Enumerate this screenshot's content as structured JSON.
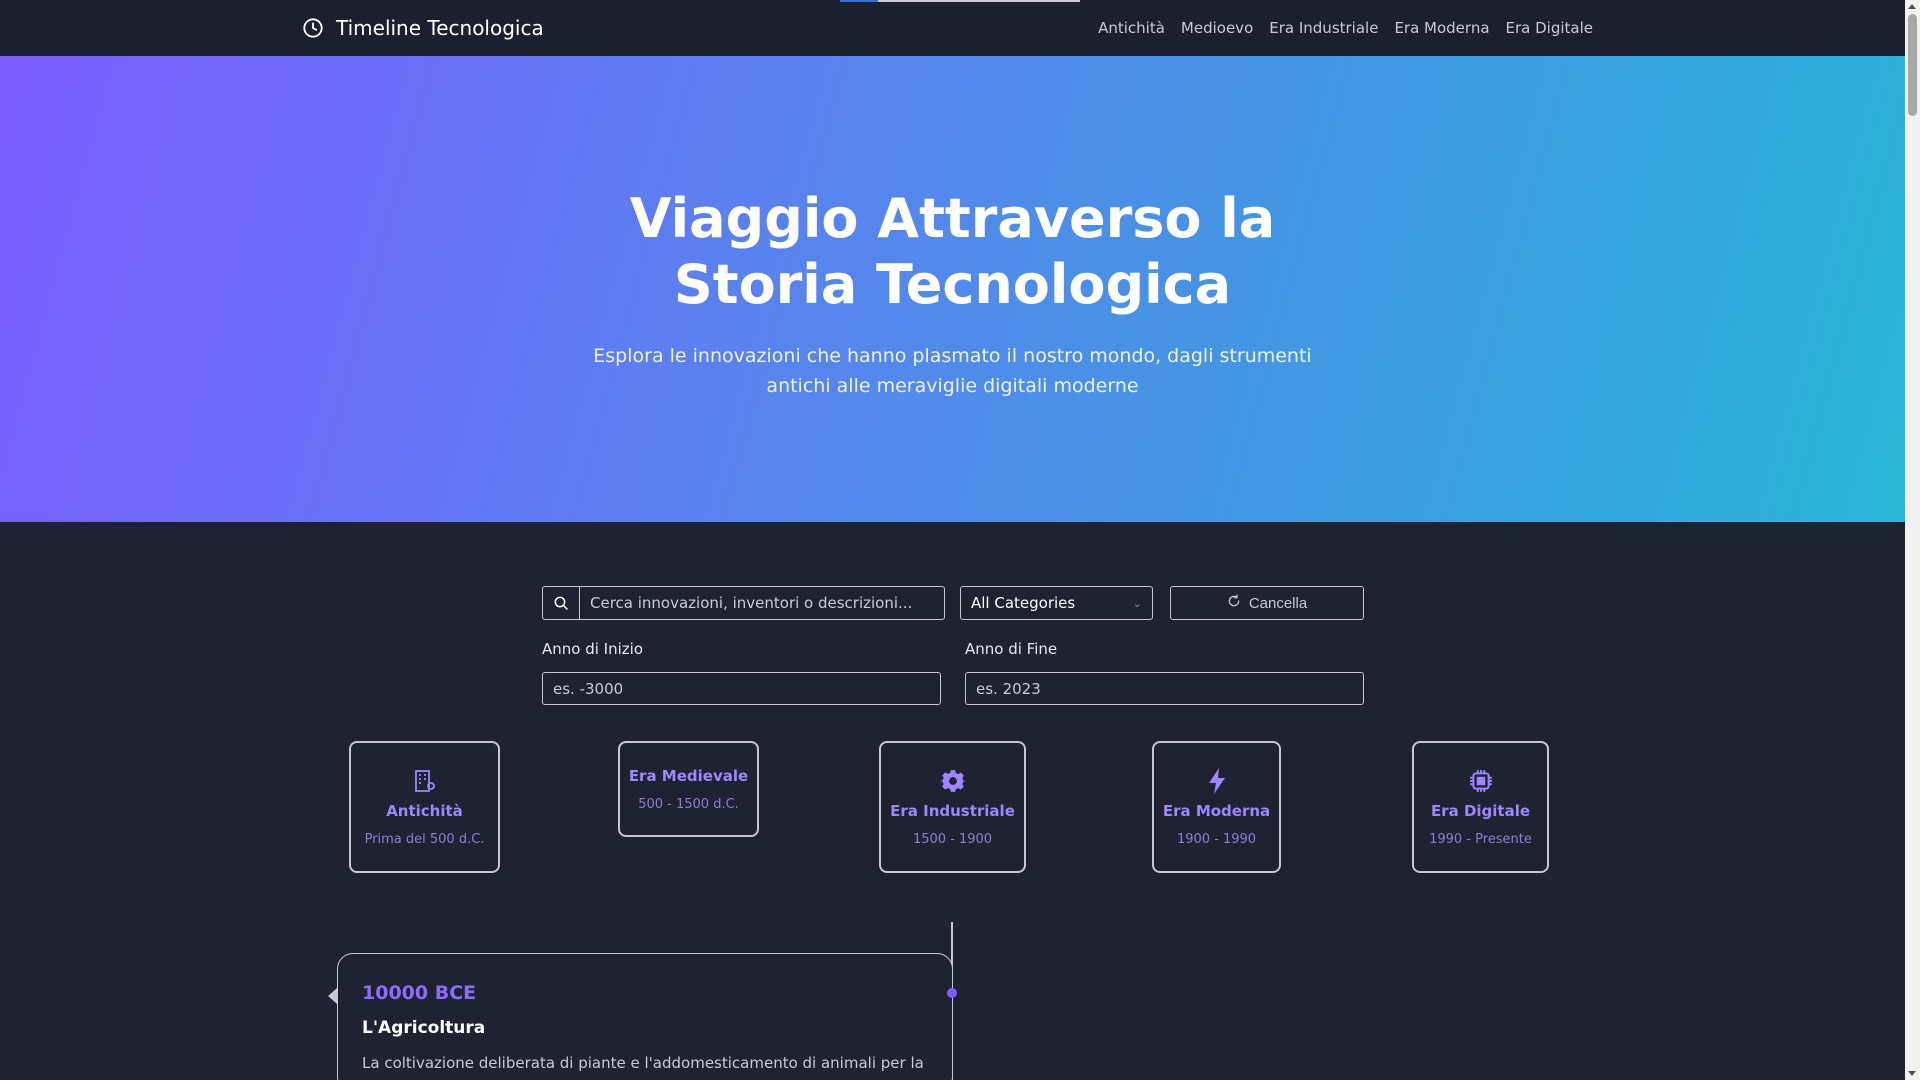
{
  "nav": {
    "brand": "Timeline Tecnologica",
    "brand_icon": "clock-icon",
    "links": [
      "Antichità",
      "Medioevo",
      "Era Industriale",
      "Era Moderna",
      "Era Digitale"
    ],
    "scroll_progress": 0.16
  },
  "hero": {
    "title": "Viaggio Attraverso la Storia Tecnologica",
    "subtitle": "Esplora le innovazioni che hanno plasmato il nostro mondo, dagli strumenti antichi alle meraviglie digitali moderne"
  },
  "filters": {
    "search_placeholder": "Cerca innovazioni, inventori o descrizioni...",
    "category_selected": "All Categories",
    "clear_label": "Cancella",
    "start_label": "Anno di Inizio",
    "start_placeholder": "es. -3000",
    "end_label": "Anno di Fine",
    "end_placeholder": "es. 2023"
  },
  "eras": [
    {
      "name": "Antichità",
      "range": "Prima del 500 d.C.",
      "icon": "building-icon"
    },
    {
      "name": "Era Medievale",
      "range": "500 - 1500 d.C.",
      "icon": ""
    },
    {
      "name": "Era Industriale",
      "range": "1500 - 1900",
      "icon": "gear-icon"
    },
    {
      "name": "Era Moderna",
      "range": "1900 - 1990",
      "icon": "lightning-icon"
    },
    {
      "name": "Era Digitale",
      "range": "1990 - Presente",
      "icon": "chip-icon"
    }
  ],
  "events": [
    {
      "year": "10000 BCE",
      "title": "L'Agricoltura",
      "description": "La coltivazione deliberata di piante e l'addomesticamento di animali per la"
    }
  ],
  "colors": {
    "accent": "#7c5cff",
    "background": "#1f2331",
    "hero_start": "#7b5cff",
    "hero_end": "#28b8d8"
  }
}
